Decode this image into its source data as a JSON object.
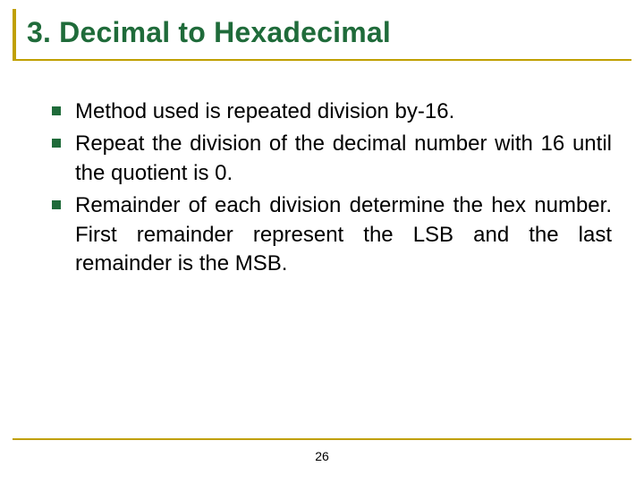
{
  "title": "3. Decimal to Hexadecimal",
  "bullets": [
    {
      "text": "Method used is repeated division by-16."
    },
    {
      "text": "Repeat the division of the decimal number with 16 until the quotient is 0."
    },
    {
      "text": "Remainder of each division determine the hex number. First remainder represent the LSB and the last remainder is the MSB."
    }
  ],
  "page_number": "26",
  "colors": {
    "accent": "#c0a000",
    "heading": "#1f6b3a",
    "bullet": "#1f6b3a"
  }
}
